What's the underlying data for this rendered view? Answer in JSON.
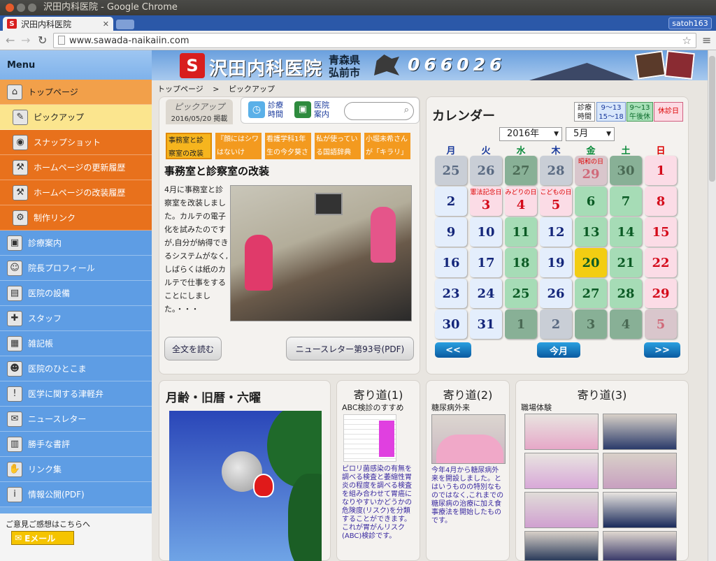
{
  "window": {
    "title": "沢田内科医院 - Google Chrome",
    "tab_label": "沢田内科医院",
    "profile": "satoh163"
  },
  "address": {
    "url": "www.sawada-naikaiin.com"
  },
  "sidebar": {
    "menu_label": "Menu",
    "items": [
      {
        "label": "トップページ",
        "icon": "home-icon"
      },
      {
        "label": "ピックアップ",
        "icon": "pencil-icon"
      },
      {
        "label": "スナップショット",
        "icon": "camera-icon"
      },
      {
        "label": "ホームページの更新履歴",
        "icon": "hammer-icon"
      },
      {
        "label": "ホームページの改装履歴",
        "icon": "hammer-icon"
      },
      {
        "label": "制作リンク",
        "icon": "wrench-icon"
      },
      {
        "label": "診療案内",
        "icon": "car-icon"
      },
      {
        "label": "院長プロフィール",
        "icon": "doctor-icon"
      },
      {
        "label": "医院の設備",
        "icon": "equipment-icon"
      },
      {
        "label": "スタッフ",
        "icon": "nurse-icon"
      },
      {
        "label": "雑記帳",
        "icon": "notebook-icon"
      },
      {
        "label": "医院のひとこま",
        "icon": "person-icon"
      },
      {
        "label": "医学に関する津軽弁",
        "icon": "alert-icon"
      },
      {
        "label": "ニュースレター",
        "icon": "newsletter-icon"
      },
      {
        "label": "勝手な書評",
        "icon": "book-icon"
      },
      {
        "label": "リンク集",
        "icon": "handshake-icon"
      },
      {
        "label": "情報公開(PDF)",
        "icon": "info-icon"
      }
    ],
    "feedback_text": "ご意見ご感想はこちらへ",
    "email_button": "Eメール"
  },
  "header": {
    "logo_text": "沢田内科医院",
    "location_1": "青森県",
    "location_2": "弘前市",
    "postal": "066026"
  },
  "breadcrumb": {
    "home": "トップページ",
    "separator": ">",
    "current": "ピックアップ"
  },
  "pickup": {
    "title": "ピックアップ",
    "date": "2016/05/20 掲載",
    "nav_1": "診療 時間",
    "nav_2": "医院 案内",
    "tabs": [
      "事務室と診察室の改装",
      "『顔にはシワはないけ",
      "看護学科1年生の今夕葵さ",
      "私が使っている国語辞典",
      "小堀未希さんが「キラリ」放"
    ],
    "article_title": "事務室と診察室の改装",
    "article_text": "4月に事務室と診察室を改装しました。カルテの電子化を試みたのですが,自分が納得できるシステムがなく,しばらくは紙のカルテで仕事をすることにしました。・・・",
    "read_more": "全文を読む",
    "newsletter_button": "ニュースレター第93号(PDF)"
  },
  "calendar": {
    "title": "カレンダー",
    "year_select": "2016年",
    "month_select": "5月",
    "legend": [
      {
        "text": "診療 時間"
      },
      {
        "text": "9～13 15～18"
      },
      {
        "text": "9～13 午後休"
      },
      {
        "text": "休診日"
      }
    ],
    "weekdays": [
      "月",
      "火",
      "水",
      "木",
      "金",
      "土",
      "日"
    ],
    "weekday_colors": [
      "#1a3a9c",
      "#1a3a9c",
      "#0a8a3a",
      "#1a3a9c",
      "#0a8a3a",
      "#0a8a3a",
      "#d00"
    ],
    "rows": [
      [
        {
          "d": "25",
          "t": "o"
        },
        {
          "d": "26",
          "t": "o"
        },
        {
          "d": "27",
          "t": "og"
        },
        {
          "d": "28",
          "t": "o"
        },
        {
          "d": "29",
          "t": "op",
          "h": "昭和の日"
        },
        {
          "d": "30",
          "t": "og"
        },
        {
          "d": "1",
          "t": "p"
        }
      ],
      [
        {
          "d": "2",
          "t": "b"
        },
        {
          "d": "3",
          "t": "p",
          "h": "憲法記念日"
        },
        {
          "d": "4",
          "t": "p",
          "h": "みどりの日"
        },
        {
          "d": "5",
          "t": "p",
          "h": "こどもの日"
        },
        {
          "d": "6",
          "t": "g"
        },
        {
          "d": "7",
          "t": "g"
        },
        {
          "d": "8",
          "t": "p"
        }
      ],
      [
        {
          "d": "9",
          "t": "b"
        },
        {
          "d": "10",
          "t": "b"
        },
        {
          "d": "11",
          "t": "g"
        },
        {
          "d": "12",
          "t": "b"
        },
        {
          "d": "13",
          "t": "g"
        },
        {
          "d": "14",
          "t": "g"
        },
        {
          "d": "15",
          "t": "p"
        }
      ],
      [
        {
          "d": "16",
          "t": "b"
        },
        {
          "d": "17",
          "t": "b"
        },
        {
          "d": "18",
          "t": "g"
        },
        {
          "d": "19",
          "t": "b"
        },
        {
          "d": "20",
          "t": "y"
        },
        {
          "d": "21",
          "t": "g"
        },
        {
          "d": "22",
          "t": "p"
        }
      ],
      [
        {
          "d": "23",
          "t": "b"
        },
        {
          "d": "24",
          "t": "b"
        },
        {
          "d": "25",
          "t": "g"
        },
        {
          "d": "26",
          "t": "b"
        },
        {
          "d": "27",
          "t": "g"
        },
        {
          "d": "28",
          "t": "g"
        },
        {
          "d": "29",
          "t": "p"
        }
      ],
      [
        {
          "d": "30",
          "t": "b"
        },
        {
          "d": "31",
          "t": "b"
        },
        {
          "d": "1",
          "t": "og"
        },
        {
          "d": "2",
          "t": "o"
        },
        {
          "d": "3",
          "t": "og"
        },
        {
          "d": "4",
          "t": "og"
        },
        {
          "d": "5",
          "t": "op"
        }
      ]
    ],
    "prev": "<<",
    "today": "今月",
    "next": ">>"
  },
  "moon": {
    "title": "月齢・旧暦・六曜"
  },
  "yorimichi1": {
    "title": "寄り道(1)",
    "subtitle": "ABC検診のすすめ",
    "text": "ピロリ菌感染の有無を調べる検査と萎縮性胃炎の程度を調べる検査を組み合わせて胃癌になりやすいかどうかの危険度(リスク)を分類することができます。これが胃がんリスク(ABC)検診です。"
  },
  "yorimichi2": {
    "title": "寄り道(2)",
    "subtitle": "糖尿病外来",
    "text": "今年4月から糖尿病外来を開設しました。とはいうものの特別なものではなく,これまでの糖尿病の治療に加え食事療法を開始したものです。"
  },
  "yorimichi3": {
    "title": "寄り道(3)",
    "subtitle": "職場体験"
  }
}
